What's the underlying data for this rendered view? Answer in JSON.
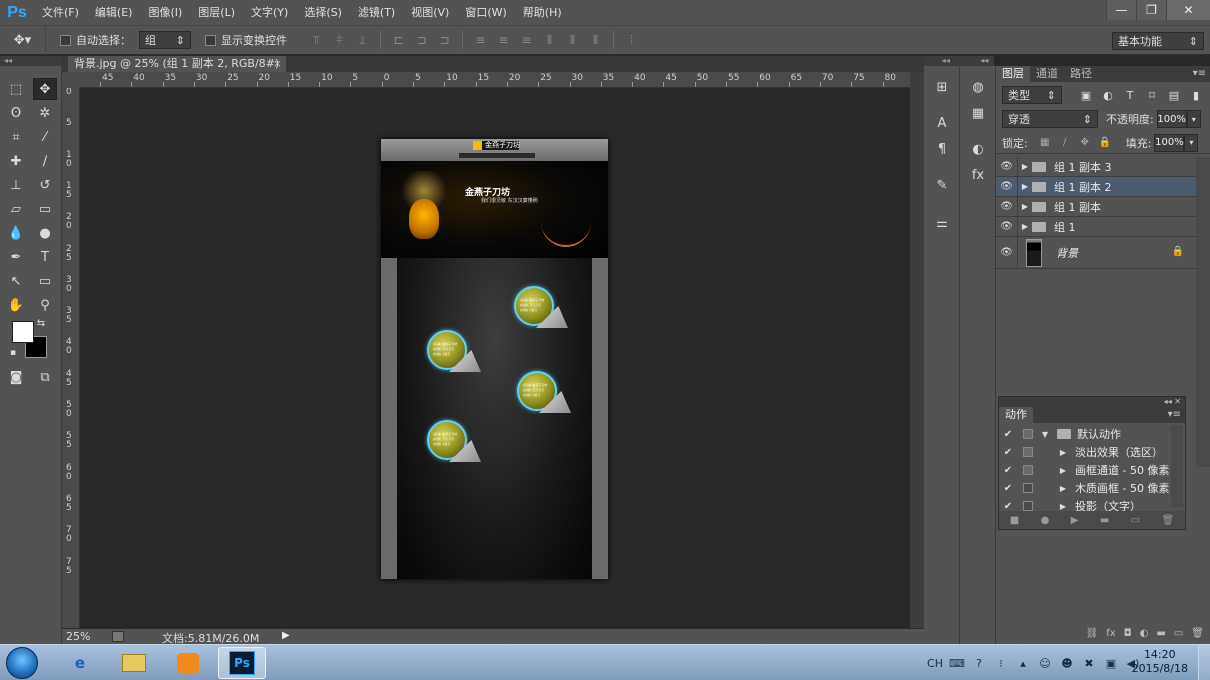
{
  "app": {
    "logo": "Ps"
  },
  "menu": [
    "文件(F)",
    "编辑(E)",
    "图像(I)",
    "图层(L)",
    "文字(Y)",
    "选择(S)",
    "滤镜(T)",
    "视图(V)",
    "窗口(W)",
    "帮助(H)"
  ],
  "window_controls": {
    "minimize": "—",
    "restore": "❐",
    "close": "✕"
  },
  "options_bar": {
    "tool_icon": "move-tool-icon",
    "auto_select_label": "自动选择：",
    "auto_select_value": "组",
    "show_transform_label": "显示变换控件",
    "workspace": "基本功能"
  },
  "document_tab": {
    "title": "背景.jpg @ 25% (组 1 副本 2, RGB/8#) *",
    "close": "×"
  },
  "rulers": {
    "horizontal": [
      "45",
      "40",
      "35",
      "30",
      "25",
      "20",
      "15",
      "10",
      "5",
      "0",
      "5",
      "10",
      "15",
      "20",
      "25",
      "30",
      "35",
      "40",
      "45",
      "50",
      "55",
      "60",
      "65",
      "70",
      "75",
      "80"
    ],
    "vertical": [
      "0",
      "5",
      "1 0",
      "1 5",
      "2 0",
      "2 5",
      "3 0",
      "3 5",
      "4 0",
      "4 5",
      "5 0",
      "5 5",
      "6 0",
      "6 5",
      "7 0",
      "7 5"
    ]
  },
  "document": {
    "logo_text": "金燕子刀坊",
    "banner_title": "金燕子刀坊",
    "banner_subtitle": "我们很灵敏  东汉汉廉懂刷",
    "spot_text": "[店铺] 金燕子刀坊\n[标题] 刀刃刀刃\n[价格] 1发刀"
  },
  "status": {
    "zoom": "25%",
    "doc_size": "文档:5.81M/26.0M",
    "arrow": "▶"
  },
  "layers_panel": {
    "tabs": [
      "图层",
      "通道",
      "路径"
    ],
    "active_tab": "图层",
    "filter": "类型",
    "blend_mode": "穿透",
    "opacity_label": "不透明度:",
    "opacity": "100%",
    "lock_label": "锁定:",
    "fill_label": "填充:",
    "fill": "100%",
    "layers": [
      {
        "name": "组 1 副本 3",
        "type": "group",
        "selected": false
      },
      {
        "name": "组 1 副本 2",
        "type": "group",
        "selected": true
      },
      {
        "name": "组 1 副本",
        "type": "group",
        "selected": false
      },
      {
        "name": "组 1",
        "type": "group",
        "selected": false
      }
    ],
    "background_layer": {
      "name": "背景"
    }
  },
  "actions_panel": {
    "tab": "动作",
    "items": [
      {
        "name": "默认动作",
        "type": "set",
        "checked": true,
        "dialog": true
      },
      {
        "name": "淡出效果（选区）",
        "type": "action",
        "checked": true,
        "dialog": true
      },
      {
        "name": "画框通道 - 50 像素",
        "type": "action",
        "checked": true,
        "dialog": true
      },
      {
        "name": "木质画框 - 50 像素",
        "type": "action",
        "checked": true,
        "dialog": false
      },
      {
        "name": "投影（文字）",
        "type": "action",
        "checked": true,
        "dialog": false
      }
    ]
  },
  "taskbar": {
    "ime": "CH",
    "time": "14:20",
    "date": "2015/8/18"
  },
  "colors": {
    "ps_blue": "#31a8ff",
    "ui_gray": "#535353",
    "canvas_bg": "#282828",
    "selected_layer": "#4d5b6e"
  }
}
